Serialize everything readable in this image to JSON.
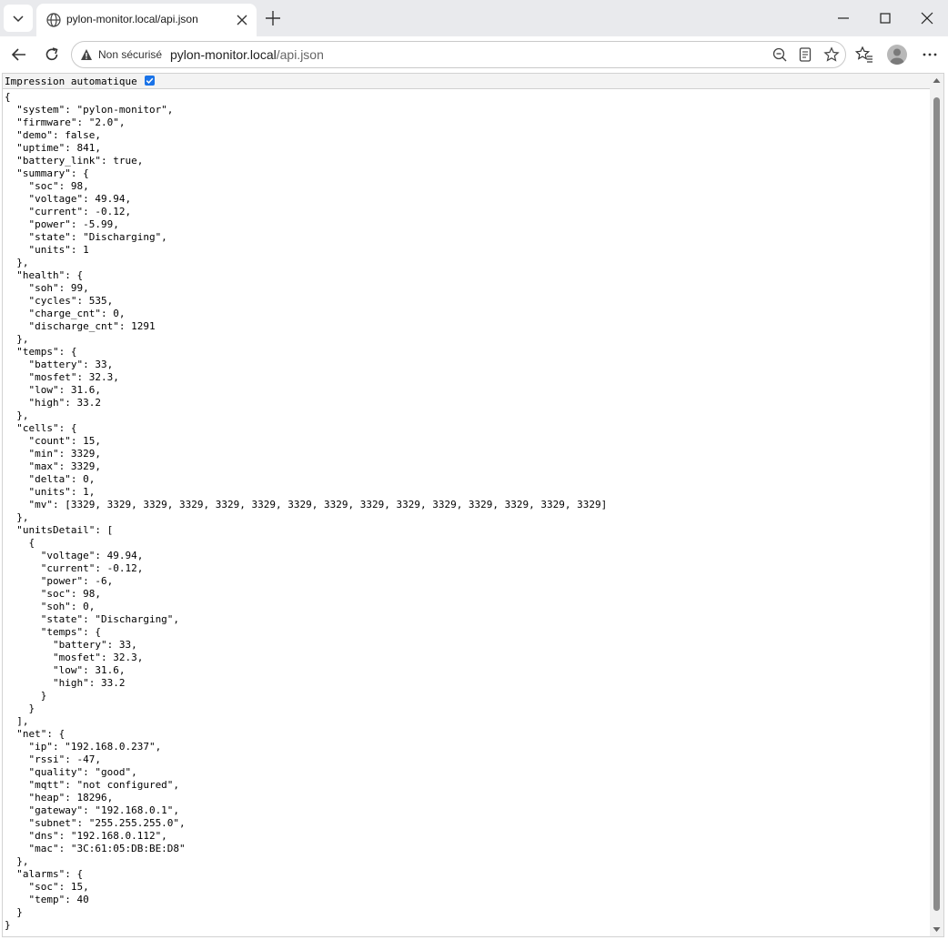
{
  "browser": {
    "tab_title": "pylon-monitor.local/api.json",
    "not_secure_label": "Non sécurisé",
    "url_host": "pylon-monitor.local",
    "url_path": "/api.json",
    "icons": [
      "tab-search-icon",
      "globe-icon",
      "close-icon",
      "plus-icon",
      "minimize-icon",
      "maximize-icon",
      "window-close-icon",
      "back-arrow-icon",
      "reload-icon",
      "warning-icon",
      "zoom-out-icon",
      "reader-mode-icon",
      "star-icon",
      "favorites-icon",
      "profile-avatar",
      "more-menu-icon"
    ]
  },
  "page": {
    "pretty_print_label": "Impression automatique",
    "pretty_print_checked": true,
    "accent_color": "#1a73e8",
    "json_lines": [
      "{",
      "  \"system\": \"pylon-monitor\",",
      "  \"firmware\": \"2.0\",",
      "  \"demo\": false,",
      "  \"uptime\": 841,",
      "  \"battery_link\": true,",
      "  \"summary\": {",
      "    \"soc\": 98,",
      "    \"voltage\": 49.94,",
      "    \"current\": -0.12,",
      "    \"power\": -5.99,",
      "    \"state\": \"Discharging\",",
      "    \"units\": 1",
      "  },",
      "  \"health\": {",
      "    \"soh\": 99,",
      "    \"cycles\": 535,",
      "    \"charge_cnt\": 0,",
      "    \"discharge_cnt\": 1291",
      "  },",
      "  \"temps\": {",
      "    \"battery\": 33,",
      "    \"mosfet\": 32.3,",
      "    \"low\": 31.6,",
      "    \"high\": 33.2",
      "  },",
      "  \"cells\": {",
      "    \"count\": 15,",
      "    \"min\": 3329,",
      "    \"max\": 3329,",
      "    \"delta\": 0,",
      "    \"units\": 1,",
      "    \"mv\": [3329, 3329, 3329, 3329, 3329, 3329, 3329, 3329, 3329, 3329, 3329, 3329, 3329, 3329, 3329]",
      "  },",
      "  \"unitsDetail\": [",
      "    {",
      "      \"voltage\": 49.94,",
      "      \"current\": -0.12,",
      "      \"power\": -6,",
      "      \"soc\": 98,",
      "      \"soh\": 0,",
      "      \"state\": \"Discharging\",",
      "      \"temps\": {",
      "        \"battery\": 33,",
      "        \"mosfet\": 32.3,",
      "        \"low\": 31.6,",
      "        \"high\": 33.2",
      "      }",
      "    }",
      "  ],",
      "  \"net\": {",
      "    \"ip\": \"192.168.0.237\",",
      "    \"rssi\": -47,",
      "    \"quality\": \"good\",",
      "    \"mqtt\": \"not configured\",",
      "    \"heap\": 18296,",
      "    \"gateway\": \"192.168.0.1\",",
      "    \"subnet\": \"255.255.255.0\",",
      "    \"dns\": \"192.168.0.112\",",
      "    \"mac\": \"3C:61:05:DB:BE:D8\"",
      "  },",
      "  \"alarms\": {",
      "    \"soc\": 15,",
      "    \"temp\": 40",
      "  }",
      "}"
    ]
  }
}
